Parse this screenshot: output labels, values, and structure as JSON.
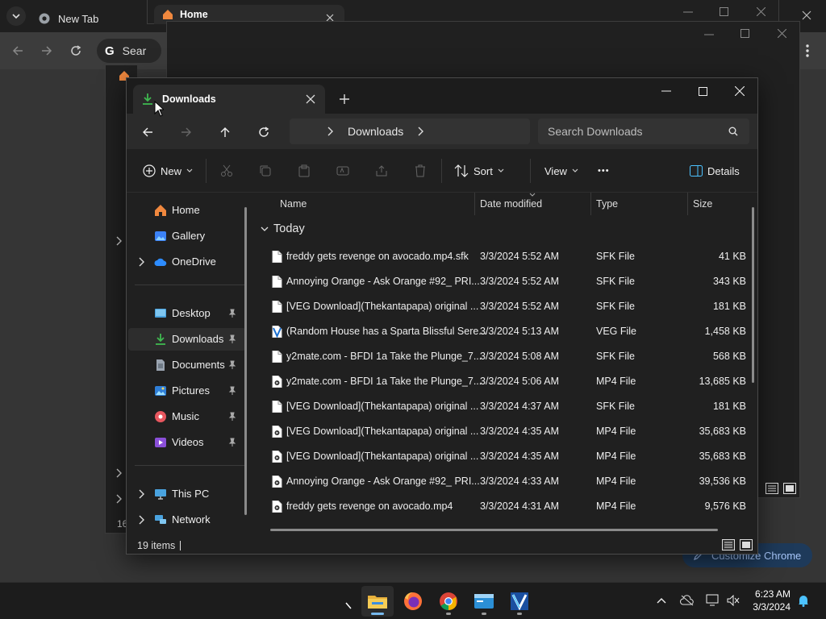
{
  "chrome": {
    "tab_title": "New Tab",
    "omnibox_text": "Sear",
    "customize_label": "Customize Chrome"
  },
  "bg_explorer": {
    "tab_title": "Home",
    "status_count": "16"
  },
  "explorer": {
    "tab_title": "Downloads",
    "breadcrumb": "Downloads",
    "search_placeholder": "Search Downloads",
    "commands": {
      "new": "New",
      "sort": "Sort",
      "view": "View",
      "more": "•••",
      "details": "Details"
    },
    "columns": [
      "Name",
      "Date modified",
      "Type",
      "Size"
    ],
    "group_label": "Today",
    "nav": {
      "home": "Home",
      "gallery": "Gallery",
      "onedrive": "OneDrive",
      "desktop": "Desktop",
      "downloads": "Downloads",
      "documents": "Documents",
      "pictures": "Pictures",
      "music": "Music",
      "videos": "Videos",
      "thispc": "This PC",
      "network": "Network"
    },
    "files": [
      {
        "name": "freddy gets revenge on avocado.mp4.sfk",
        "date": "3/3/2024 5:52 AM",
        "type": "SFK File",
        "size": "41 KB",
        "icon": "doc"
      },
      {
        "name": "Annoying Orange - Ask Orange #92_ PRI...",
        "date": "3/3/2024 5:52 AM",
        "type": "SFK File",
        "size": "343 KB",
        "icon": "doc"
      },
      {
        "name": "[VEG Download](Thekantapapa) original ...",
        "date": "3/3/2024 5:52 AM",
        "type": "SFK File",
        "size": "181 KB",
        "icon": "doc"
      },
      {
        "name": "(Random House has a Sparta Blissful Sere...",
        "date": "3/3/2024 5:13 AM",
        "type": "VEG File",
        "size": "1,458 KB",
        "icon": "veg"
      },
      {
        "name": "y2mate.com - BFDI 1a Take the Plunge_7...",
        "date": "3/3/2024 5:08 AM",
        "type": "SFK File",
        "size": "568 KB",
        "icon": "doc"
      },
      {
        "name": "y2mate.com - BFDI 1a Take the Plunge_7...",
        "date": "3/3/2024 5:06 AM",
        "type": "MP4 File",
        "size": "13,685 KB",
        "icon": "video"
      },
      {
        "name": "[VEG Download](Thekantapapa) original ...",
        "date": "3/3/2024 4:37 AM",
        "type": "SFK File",
        "size": "181 KB",
        "icon": "doc"
      },
      {
        "name": "[VEG Download](Thekantapapa) original ...",
        "date": "3/3/2024 4:35 AM",
        "type": "MP4 File",
        "size": "35,683 KB",
        "icon": "video"
      },
      {
        "name": "[VEG Download](Thekantapapa) original ...",
        "date": "3/3/2024 4:35 AM",
        "type": "MP4 File",
        "size": "35,683 KB",
        "icon": "video"
      },
      {
        "name": "Annoying Orange - Ask Orange #92_ PRI...",
        "date": "3/3/2024 4:33 AM",
        "type": "MP4 File",
        "size": "39,536 KB",
        "icon": "video"
      },
      {
        "name": "freddy gets revenge on avocado.mp4",
        "date": "3/3/2024 4:31 AM",
        "type": "MP4 File",
        "size": "9,576 KB",
        "icon": "video"
      }
    ],
    "status": {
      "items": "19 items"
    }
  },
  "taskbar": {
    "time": "6:23 AM",
    "date": "3/3/2024"
  },
  "colors": {
    "accent": "#4cc2ff",
    "folder_yellow": "#f4c342",
    "download_green": "#3fb950"
  }
}
